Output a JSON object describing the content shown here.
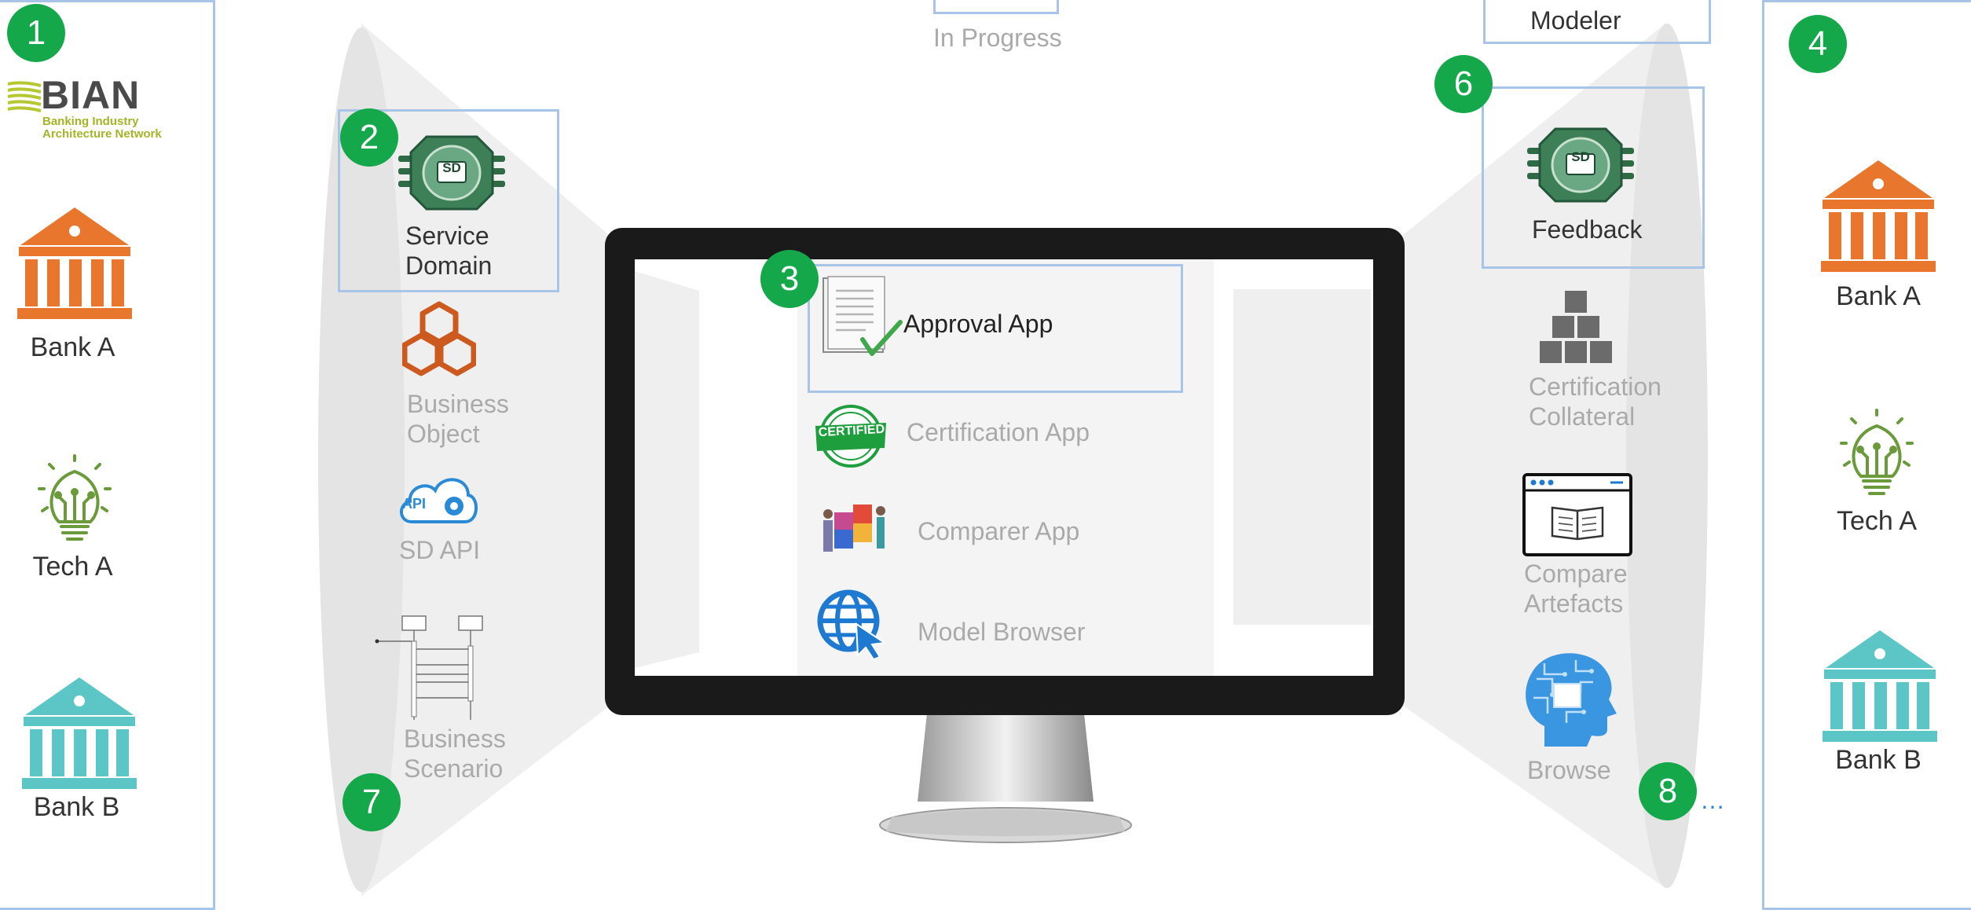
{
  "left_panel": {
    "badge": "1",
    "logo_text": "BIAN",
    "logo_subtitle_1": "Banking Industry",
    "logo_subtitle_2": "Architecture Network",
    "items": [
      {
        "label": "Bank A"
      },
      {
        "label": "Tech A"
      },
      {
        "label": "Bank B"
      }
    ]
  },
  "left_group": {
    "badge_2": "2",
    "badge_7": "7",
    "sd_icon_text": "SD",
    "service_domain": [
      "Service",
      "Domain"
    ],
    "business_object": [
      "Business",
      "Object"
    ],
    "sd_api": "SD API",
    "api_icon_text": "API",
    "business_scenario": [
      "Business",
      "Scenario"
    ]
  },
  "top": {
    "top_center_label": "In Progress",
    "top_right_label": "Modeler"
  },
  "monitor": {
    "badge": "3",
    "apps": [
      {
        "label": "Approval App"
      },
      {
        "label": "Certification App"
      },
      {
        "label": "Comparer App"
      },
      {
        "label": "Model Browser"
      }
    ],
    "certified_text": "CERTIFIED"
  },
  "right_group": {
    "badge_6": "6",
    "badge_8": "8",
    "sd_icon_text": "SD",
    "feedback": "Feedback",
    "certification_collateral": [
      "Certification",
      "Collateral"
    ],
    "compare_artefacts": [
      "Compare",
      "Artefacts"
    ],
    "browse": "Browse",
    "ellipsis": "…"
  },
  "right_panel": {
    "badge": "4",
    "items": [
      {
        "label": "Bank A"
      },
      {
        "label": "Tech A"
      },
      {
        "label": "Bank B"
      }
    ]
  },
  "colors": {
    "badge_green": "#14a84a",
    "panel_border": "#a8c4e6",
    "bank_orange": "#e8762c",
    "bank_teal": "#5cc6c6",
    "tech_green": "#6a9a3a",
    "sd_green": "#2e6b45"
  }
}
